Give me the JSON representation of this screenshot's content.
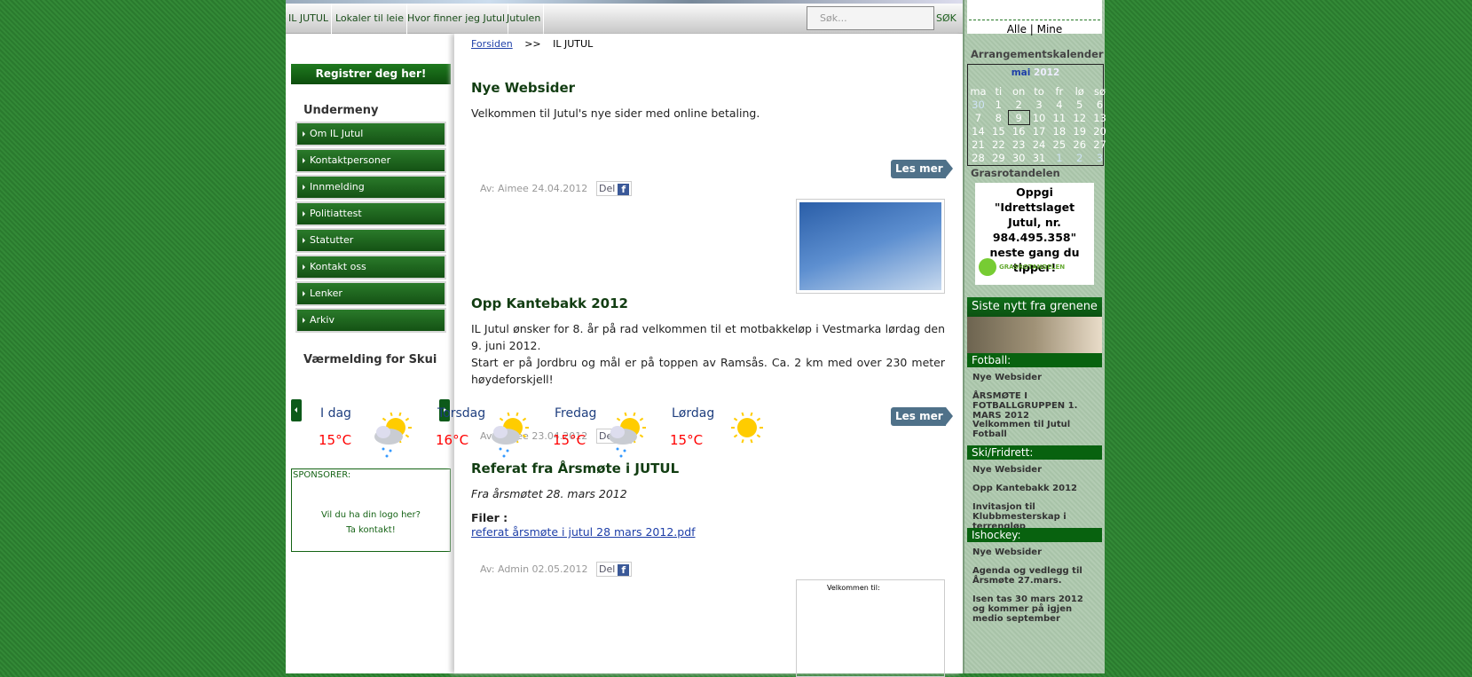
{
  "nav": {
    "items": [
      "IL JUTUL",
      "Lokaler til leie",
      "Hvor finner jeg Jutul",
      "Jutulen"
    ],
    "search_placeholder": "Søk...",
    "search_button": "SØK"
  },
  "left": {
    "register": "Registrer deg her!",
    "submenu_title": "Undermeny",
    "submenu": [
      "Om IL Jutul",
      "Kontaktpersoner",
      "Innmelding",
      "Politiattest",
      "Statutter",
      "Kontakt oss",
      "Lenker",
      "Arkiv"
    ],
    "weather_title": "Værmelding for Skui",
    "sponsors_title": "SPONSORER:",
    "sponsors_text1": "Vil du ha din logo her?",
    "sponsors_text2": "Ta kontakt!"
  },
  "weather": [
    {
      "day": "I dag",
      "temp": "15°C",
      "icon": "partly-cloudy-rain-icon"
    },
    {
      "day": "Torsdag",
      "temp": "16°C",
      "icon": "partly-cloudy-rain-icon"
    },
    {
      "day": "Fredag",
      "temp": "15°C",
      "icon": "partly-cloudy-rain-icon"
    },
    {
      "day": "Lørdag",
      "temp": "15°C",
      "icon": "sun-icon"
    }
  ],
  "breadcrumb": {
    "home": "Forsiden",
    "sep": ">>",
    "current": "IL JUTUL"
  },
  "articles": [
    {
      "title": "Nye Websider",
      "body": "Velkommen til Jutul's nye sider med online betaling.",
      "read_more": "Les mer",
      "meta": "Av: Aimee 24.04.2012",
      "share": "Del"
    },
    {
      "title": "Opp Kantebakk 2012",
      "body1": "IL Jutul ønsker for 8. år på rad velkommen til et motbakkeløp i Vestmarka lørdag den 9. juni 2012.",
      "body2": "Start er på Jordbru og mål er på toppen av Ramsås. Ca. 2 km med over 230 meter høydeforskjell!",
      "read_more": "Les mer",
      "meta": "Av: Aimee 23.04.2012",
      "share": "Del"
    },
    {
      "title": "Referat fra Årsmøte i JUTUL",
      "subtitle": "Fra årsmøtet 28. mars 2012",
      "files_label": "Filer :",
      "file": "referat årsmøte i jutul 28 mars 2012.pdf",
      "meta": "Av: Admin 02.05.2012",
      "share": "Del",
      "image_text": "Velkommen til:"
    }
  ],
  "right": {
    "top_links": "Alle | Mine",
    "calendar_title": "Arrangementskalender",
    "month": "mai",
    "year": "2012",
    "weekdays": [
      "ma",
      "ti",
      "on",
      "to",
      "fr",
      "lø",
      "sø"
    ],
    "weeks": [
      [
        "30",
        "1",
        "2",
        "3",
        "4",
        "5",
        "6"
      ],
      [
        "7",
        "8",
        "9",
        "10",
        "11",
        "12",
        "13"
      ],
      [
        "14",
        "15",
        "16",
        "17",
        "18",
        "19",
        "20"
      ],
      [
        "21",
        "22",
        "23",
        "24",
        "25",
        "26",
        "27"
      ],
      [
        "28",
        "29",
        "30",
        "31",
        "1",
        "2",
        "3"
      ]
    ],
    "grasrot_title": "Grasrotandelen",
    "grasrot_text": "Oppgi \"Idrettslaget Jutul, nr. 984.495.358\" neste gang du tipper!",
    "grasrot_logo": "GRASROTANDELEN",
    "news_title": "Siste nytt fra grenene",
    "categories": [
      {
        "name": "Fotball:",
        "items": [
          "Nye Websider",
          "ÅRSMØTE I FOTBALLGRUPPEN 1. MARS 2012",
          "Velkommen til Jutul Fotball"
        ]
      },
      {
        "name": "Ski/Fridrett:",
        "items": [
          "Nye Websider",
          "Opp Kantebakk 2012",
          "Invitasjon til Klubbmesterskap i terrengløp"
        ]
      },
      {
        "name": "Ishockey:",
        "items": [
          "Nye Websider",
          "Agenda og vedlegg til Årsmøte 27.mars.",
          "Isen tas 30 mars 2012 og kommer på igjen medio september"
        ]
      }
    ]
  }
}
